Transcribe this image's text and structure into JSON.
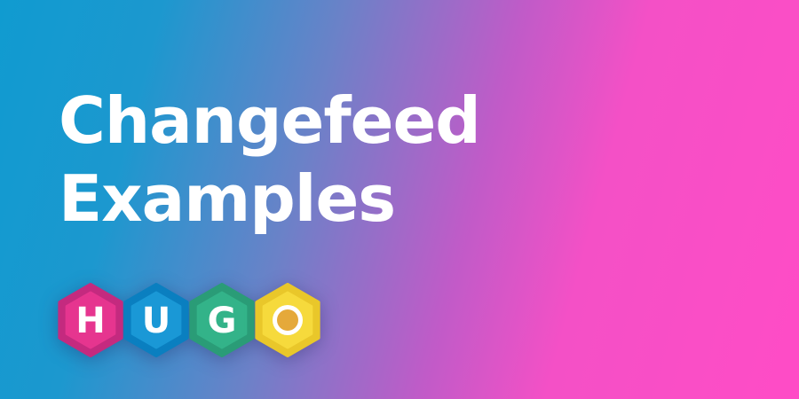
{
  "banner": {
    "title_line1": "Changefeed",
    "title_line2": "Examples",
    "background": {
      "start_color": "#109bd0",
      "end_color": "#ff4cc6"
    }
  },
  "logo": {
    "name": "HUGO",
    "letters": [
      {
        "char": "H",
        "outer": "#c42a7f",
        "inner": "#e6358f",
        "text": "#ffffff"
      },
      {
        "char": "U",
        "outer": "#0a7fc0",
        "inner": "#1a98d6",
        "text": "#ffffff"
      },
      {
        "char": "G",
        "outer": "#2a9c77",
        "inner": "#33b389",
        "text": "#ffffff"
      },
      {
        "char": "O",
        "outer": "#e9c72a",
        "inner": "#f6da3c",
        "text": "#e5a93a"
      }
    ]
  }
}
